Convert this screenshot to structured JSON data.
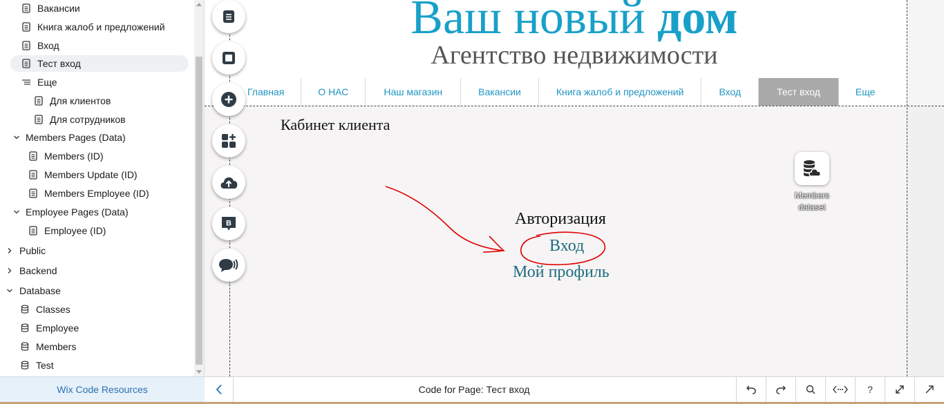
{
  "sidebar": {
    "items": [
      {
        "label": "Вакансии",
        "icon": "page-icon"
      },
      {
        "label": "Книга жалоб и предложений",
        "icon": "page-icon"
      },
      {
        "label": "Вход",
        "icon": "page-icon"
      },
      {
        "label": "Тест вход",
        "icon": "page-icon",
        "selected": true
      },
      {
        "label": "Еще",
        "icon": "menu-lines-icon"
      },
      {
        "label": "Для клиентов",
        "icon": "page-icon"
      },
      {
        "label": "Для сотрудников",
        "icon": "page-icon"
      }
    ],
    "groups": [
      {
        "label": "Members Pages (Data)",
        "children": [
          "Members (ID)",
          "Members Update (ID)",
          "Members Employee (ID)"
        ]
      },
      {
        "label": "Employee Pages (Data)",
        "children": [
          "Employee (ID)"
        ]
      }
    ],
    "sections": [
      {
        "label": "Public",
        "expanded": false
      },
      {
        "label": "Backend",
        "expanded": false
      },
      {
        "label": "Database",
        "expanded": true,
        "children": [
          "Classes",
          "Employee",
          "Members",
          "Test"
        ]
      }
    ],
    "resources_label": "Wix Code Resources"
  },
  "site": {
    "title_regular": "Ваш новый ",
    "title_bold": "дом",
    "subtitle": "Агентство недвижимости",
    "menu": [
      "Главная",
      "О НАС",
      "Наш магазин",
      "Вакансии",
      "Книга жалоб и предложений",
      "Вход",
      "Тест вход",
      "Еще"
    ],
    "active_menu": "Тест вход",
    "cabinet_heading": "Кабинет клиента",
    "auth_heading": "Авторизация",
    "login_link": "Вход",
    "profile_link": "Мой профиль",
    "dataset_label": "Members dataset"
  },
  "tools": [
    "pages-icon",
    "background-icon",
    "add-icon",
    "add-apps-icon",
    "upload-icon",
    "blog-icon",
    "chat-icon"
  ],
  "bottom_bar": {
    "title": "Code for Page: Тест вход",
    "buttons": [
      "undo-icon",
      "redo-icon",
      "search-icon",
      "code-icon",
      "help-icon",
      "expand-icon",
      "open-external-icon"
    ],
    "help_label": "?"
  },
  "colors": {
    "accent": "#18a0c9",
    "menu_active_bg": "#a9a9a9",
    "link": "#1f6d80",
    "annotation": "#e00000",
    "resources_bg": "#e6f1fa"
  }
}
